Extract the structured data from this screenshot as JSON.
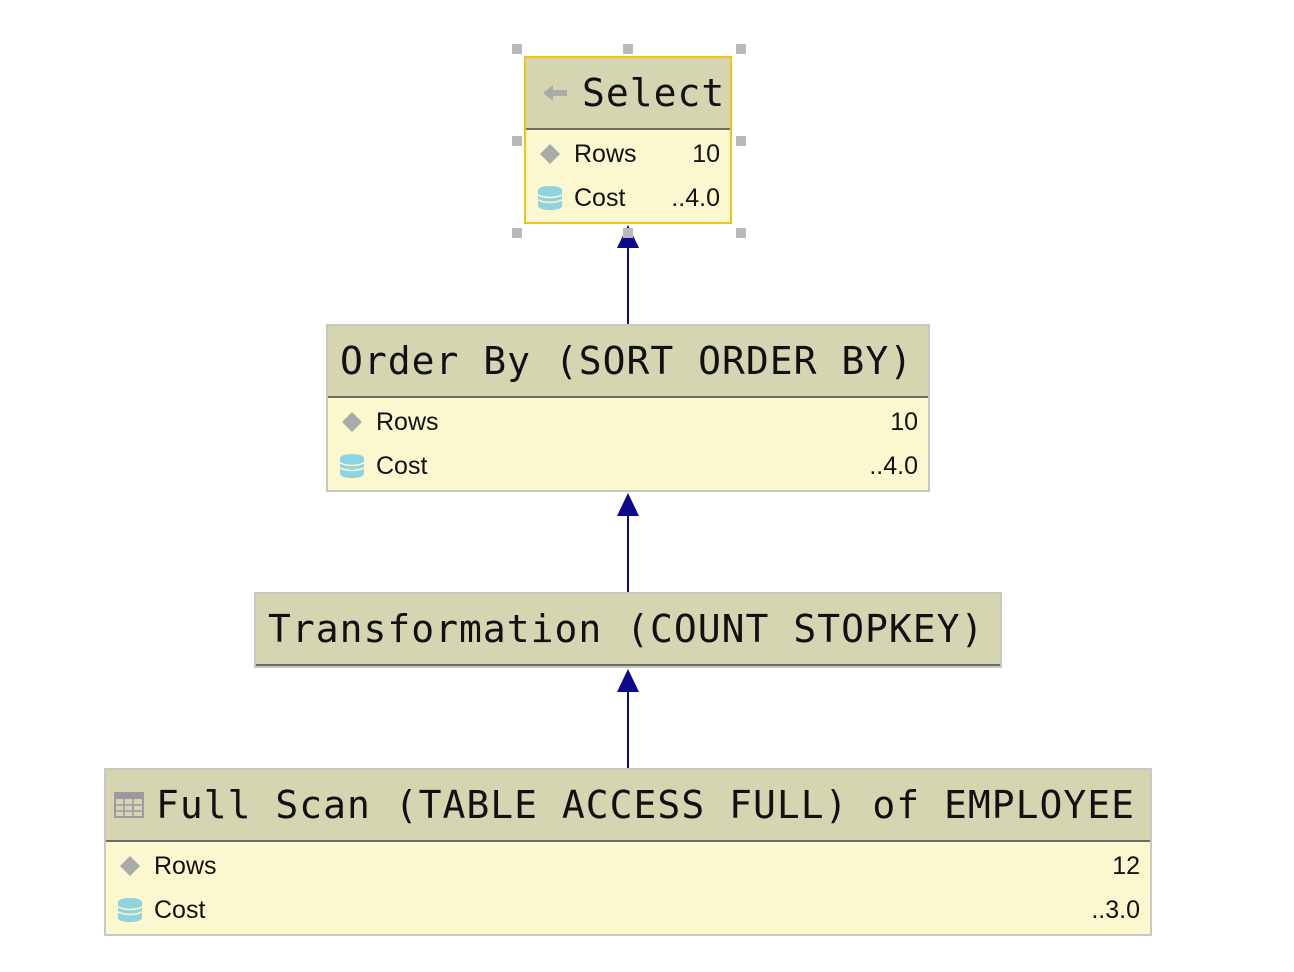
{
  "plan": {
    "nodes": [
      {
        "id": "select",
        "title": "Select",
        "icon": "arrow-left-icon",
        "selected": true,
        "rows_label": "Rows",
        "rows_value": "10",
        "cost_label": "Cost",
        "cost_value": "..4.0"
      },
      {
        "id": "order-by",
        "title": "Order By (SORT ORDER BY)",
        "rows_label": "Rows",
        "rows_value": "10",
        "cost_label": "Cost",
        "cost_value": "..4.0"
      },
      {
        "id": "transformation",
        "title": "Transformation (COUNT STOPKEY)"
      },
      {
        "id": "full-scan",
        "title": "Full Scan (TABLE ACCESS FULL) of EMPLOYEE",
        "icon": "table-icon",
        "rows_label": "Rows",
        "rows_value": "12",
        "cost_label": "Cost",
        "cost_value": "..3.0"
      }
    ]
  },
  "colors": {
    "header_bg": "#d6d5b1",
    "body_bg": "#fbf8cf",
    "selection_border": "#f2c21b",
    "edge": "#0a0a8a",
    "rows_icon": "#a8aba8",
    "cost_icon": "#8fd3df"
  }
}
